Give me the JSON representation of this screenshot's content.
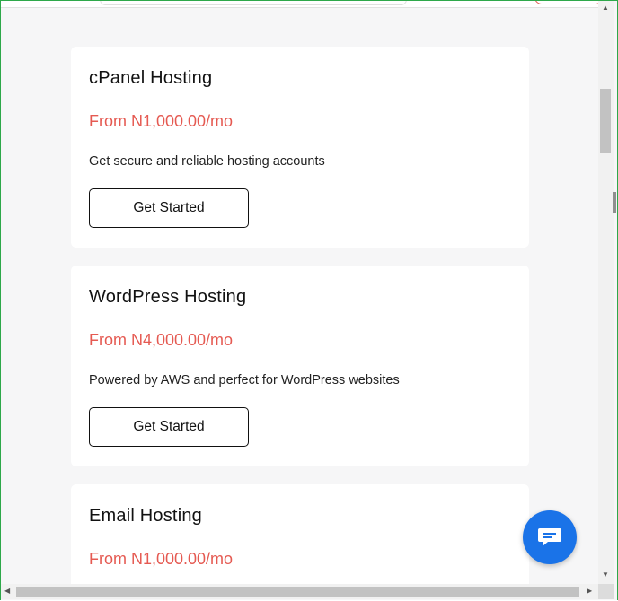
{
  "cards": [
    {
      "title": "cPanel Hosting",
      "price": "From N1,000.00/mo",
      "description": "Get secure and reliable hosting accounts",
      "button_label": "Get Started"
    },
    {
      "title": "WordPress Hosting",
      "price": "From N4,000.00/mo",
      "description": "Powered by AWS and perfect for WordPress websites",
      "button_label": "Get Started"
    },
    {
      "title": "Email Hosting",
      "price": "From N1,000.00/mo"
    }
  ],
  "colors": {
    "price": "#e55a52",
    "chat_button": "#1a73e8",
    "window_border": "#2ea84a"
  },
  "icons": {
    "chat": "chat-bubble-icon"
  }
}
